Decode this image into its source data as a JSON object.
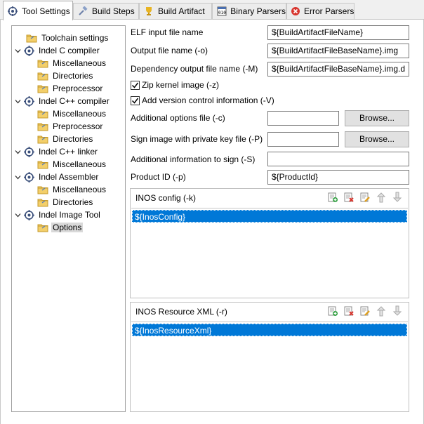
{
  "tabs": [
    {
      "label": "Tool Settings",
      "icon": "gear-icon",
      "active": true
    },
    {
      "label": "Build Steps",
      "icon": "hammer-icon",
      "active": false
    },
    {
      "label": "Build Artifact",
      "icon": "trophy-icon",
      "active": false
    },
    {
      "label": "Binary Parsers",
      "icon": "binary-icon",
      "active": false
    },
    {
      "label": "Error Parsers",
      "icon": "error-icon",
      "active": false
    }
  ],
  "tree": [
    {
      "label": "Toolchain settings",
      "type": "folder",
      "level": 1
    },
    {
      "label": "Indel C compiler",
      "type": "tool",
      "level": 0,
      "expanded": true
    },
    {
      "label": "Miscellaneous",
      "type": "folder",
      "level": 2
    },
    {
      "label": "Directories",
      "type": "folder",
      "level": 2
    },
    {
      "label": "Preprocessor",
      "type": "folder",
      "level": 2
    },
    {
      "label": "Indel C++ compiler",
      "type": "tool",
      "level": 0,
      "expanded": true
    },
    {
      "label": "Miscellaneous",
      "type": "folder",
      "level": 2
    },
    {
      "label": "Preprocessor",
      "type": "folder",
      "level": 2
    },
    {
      "label": "Directories",
      "type": "folder",
      "level": 2
    },
    {
      "label": "Indel C++ linker",
      "type": "tool",
      "level": 0,
      "expanded": true
    },
    {
      "label": "Miscellaneous",
      "type": "folder",
      "level": 2
    },
    {
      "label": "Indel Assembler",
      "type": "tool",
      "level": 0,
      "expanded": true
    },
    {
      "label": "Miscellaneous",
      "type": "folder",
      "level": 2
    },
    {
      "label": "Directories",
      "type": "folder",
      "level": 2
    },
    {
      "label": "Indel Image Tool",
      "type": "tool",
      "level": 0,
      "expanded": true
    },
    {
      "label": "Options",
      "type": "folder",
      "level": 2,
      "selected": true
    }
  ],
  "form": {
    "elf_label": "ELF input file name",
    "elf_value": "${BuildArtifactFileName}",
    "output_label": "Output file name (-o)",
    "output_value": "${BuildArtifactFileBaseName}.img",
    "dep_label": "Dependency output file name (-M)",
    "dep_value": "${BuildArtifactFileBaseName}.img.d",
    "zip_label": "Zip kernel image (-z)",
    "zip_checked": true,
    "vc_label": "Add version control information (-V)",
    "vc_checked": true,
    "addopt_label": "Additional options file (-c)",
    "addopt_value": "",
    "sign_label": "Sign image with private key file (-P)",
    "sign_value": "",
    "browse_label": "Browse...",
    "addinfo_label": "Additional information to sign (-S)",
    "addinfo_value": "",
    "product_label": "Product ID (-p)",
    "product_value": "${ProductId}"
  },
  "inos_config": {
    "title": "INOS config (-k)",
    "items": [
      "${InosConfig}"
    ]
  },
  "inos_resource": {
    "title": "INOS Resource XML (-r)",
    "items": [
      "${InosResourceXml}"
    ]
  },
  "list_actions": [
    "add-icon",
    "delete-icon",
    "edit-icon",
    "move-up-icon",
    "move-down-icon"
  ],
  "colors": {
    "selection": "#0078d7",
    "tree_selection": "#d9d9d9"
  }
}
